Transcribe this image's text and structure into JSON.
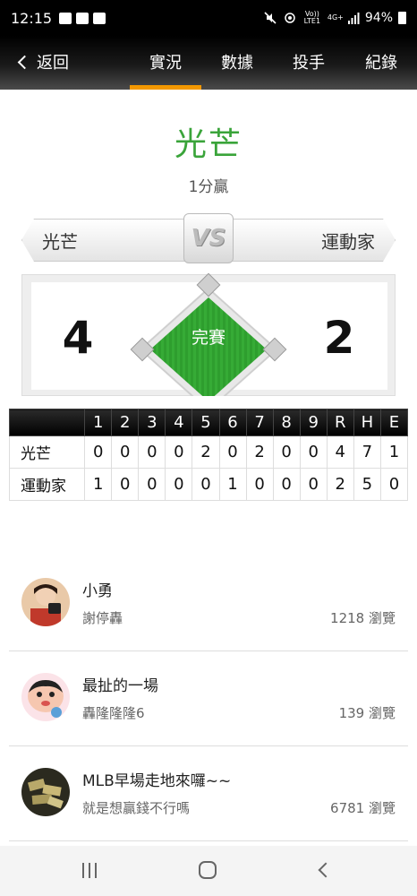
{
  "status_bar": {
    "time": "12:15",
    "network": "Vo)) LTE1",
    "signal_type": "4G+",
    "battery": "94%"
  },
  "nav": {
    "back_label": "返回",
    "tabs": [
      "實況",
      "數據",
      "投手",
      "紀錄"
    ],
    "active_tab": "實況"
  },
  "result": {
    "winner": "光芒",
    "margin": "1分贏"
  },
  "matchup": {
    "home_team": "光芒",
    "away_team": "運動家",
    "vs_label": "VS",
    "home_score": "4",
    "away_score": "2",
    "status": "完賽"
  },
  "linescore": {
    "headers": [
      "1",
      "2",
      "3",
      "4",
      "5",
      "6",
      "7",
      "8",
      "9",
      "R",
      "H",
      "E"
    ],
    "rows": [
      {
        "team": "光芒",
        "values": [
          "0",
          "0",
          "0",
          "0",
          "2",
          "0",
          "2",
          "0",
          "0",
          "4",
          "7",
          "1"
        ]
      },
      {
        "team": "運動家",
        "values": [
          "1",
          "0",
          "0",
          "0",
          "0",
          "1",
          "0",
          "0",
          "0",
          "2",
          "5",
          "0"
        ]
      }
    ]
  },
  "posts": [
    {
      "title": "小勇",
      "author": "謝停轟",
      "views": "1218 瀏覽"
    },
    {
      "title": "最扯的一場",
      "author": "轟隆隆隆6",
      "views": "139 瀏覽"
    },
    {
      "title": "MLB早場走地來囉~~",
      "author": "就是想贏錢不行嗎",
      "views": "6781 瀏覽"
    }
  ],
  "colors": {
    "accent": "#f39800",
    "winner_green": "#3aa43a",
    "field_green": "#2e9e2e"
  }
}
